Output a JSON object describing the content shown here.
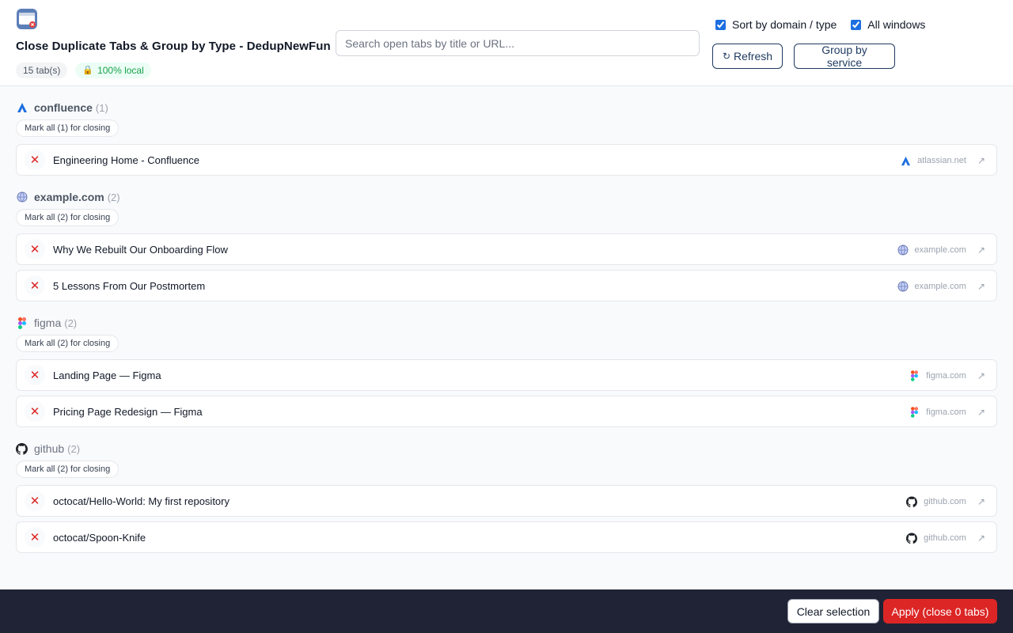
{
  "header": {
    "title": "Close Duplicate Tabs & Group by Type - DedupNewFun",
    "tab_count": "15 tab(s)",
    "local_badge": "100% local",
    "search_placeholder": "Search open tabs by title or URL...",
    "sort_label": "Sort by domain / type",
    "sort_checked": true,
    "all_windows_label": "All windows",
    "all_windows_checked": true,
    "refresh_label": "Refresh",
    "group_label": "Group by service"
  },
  "groups": [
    {
      "name": "confluence",
      "count": "(1)",
      "icon": "atlassian-icon",
      "mark_all": "Mark all (1) for closing",
      "tabs": [
        {
          "title": "Engineering Home - Confluence",
          "domain": "atlassian.net"
        }
      ]
    },
    {
      "name": "example.com",
      "count": "(2)",
      "icon": "globe-icon",
      "mark_all": "Mark all (2) for closing",
      "tabs": [
        {
          "title": "Why We Rebuilt Our Onboarding Flow",
          "domain": "example.com"
        },
        {
          "title": "5 Lessons From Our Postmortem",
          "domain": "example.com"
        }
      ]
    },
    {
      "name": "figma",
      "count": "(2)",
      "icon": "figma-icon",
      "mark_all": "Mark all (2) for closing",
      "tabs": [
        {
          "title": "Landing Page — Figma",
          "domain": "figma.com"
        },
        {
          "title": "Pricing Page Redesign — Figma",
          "domain": "figma.com"
        }
      ]
    },
    {
      "name": "github",
      "count": "(2)",
      "icon": "github-icon",
      "mark_all": "Mark all (2) for closing",
      "tabs": [
        {
          "title": "octocat/Hello-World: My first repository",
          "domain": "github.com"
        },
        {
          "title": "octocat/Spoon-Knife",
          "domain": "github.com"
        }
      ]
    }
  ],
  "footer": {
    "clear_label": "Clear selection",
    "apply_label": "Apply (close 0 tabs)"
  },
  "colors": {
    "accent": "#1e3a5f",
    "danger": "#dc2626",
    "footer_bg": "#1f2335"
  }
}
